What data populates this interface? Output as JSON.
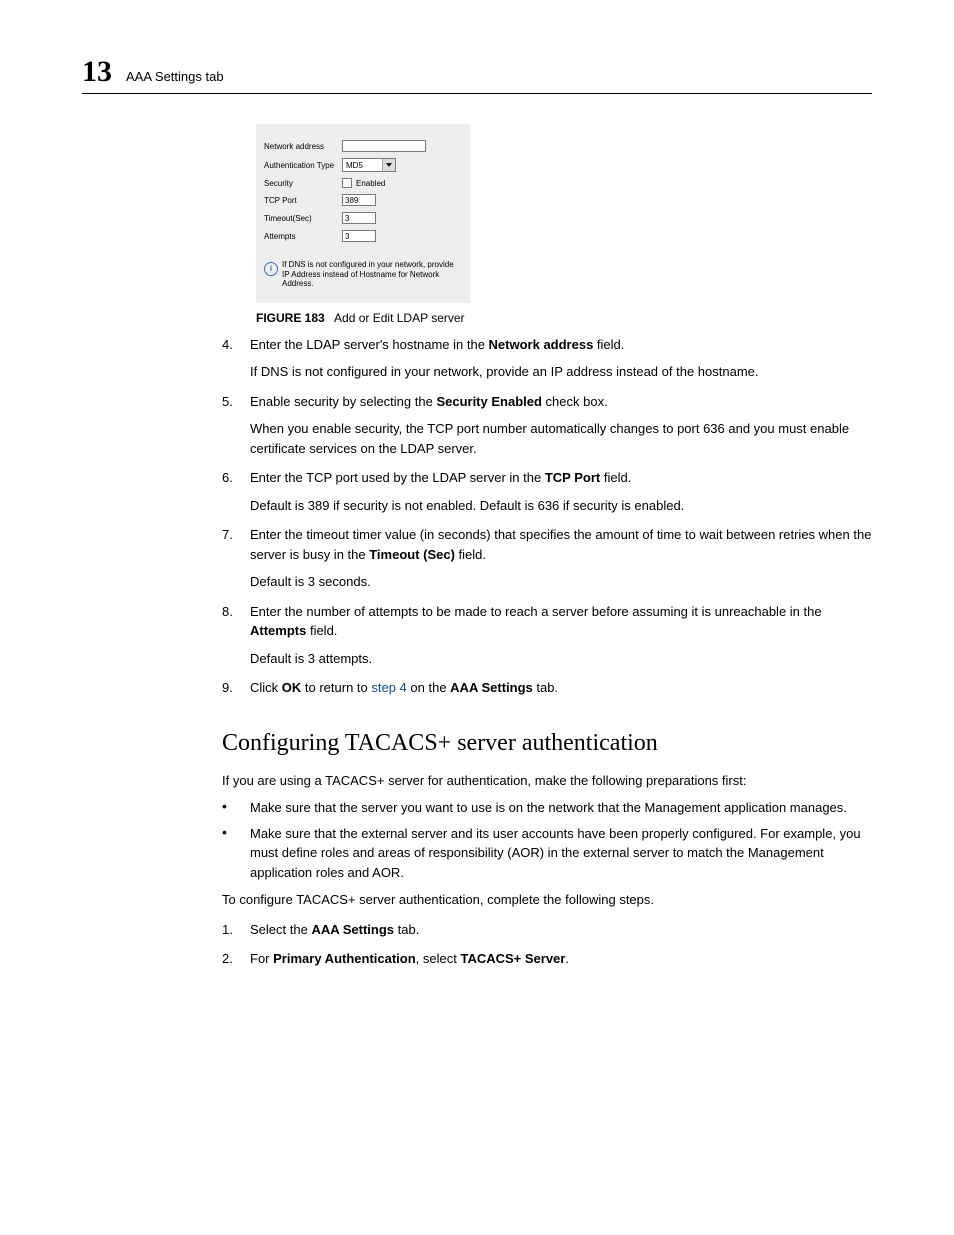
{
  "header": {
    "chapter": "13",
    "title": "AAA Settings tab"
  },
  "dialog": {
    "rows": {
      "network_address": {
        "label": "Network address",
        "value": ""
      },
      "auth_type": {
        "label": "Authentication Type",
        "value": "MD5"
      },
      "security": {
        "label": "Security",
        "checkbox_label": "Enabled"
      },
      "tcp_port": {
        "label": "TCP Port",
        "value": "389"
      },
      "timeout": {
        "label": "Timeout(Sec)",
        "value": "3"
      },
      "attempts": {
        "label": "Attempts",
        "value": "3"
      }
    },
    "note": "If DNS is not configured in your network, provide IP Address instead of Hostname for Network Address."
  },
  "figure": {
    "label": "FIGURE 183",
    "caption": "Add or Edit LDAP server"
  },
  "steps1": [
    {
      "n": "4.",
      "t1": "Enter the LDAP server's hostname in the ",
      "b1": "Network address",
      "t2": " field.",
      "sub": "If DNS is not configured in your network, provide an IP address instead of the hostname."
    },
    {
      "n": "5.",
      "t1": "Enable security by selecting the ",
      "b1": "Security Enabled",
      "t2": " check box.",
      "sub": "When you enable security, the TCP port number automatically changes to port 636 and you must enable certificate services on the LDAP server."
    },
    {
      "n": "6.",
      "t1": "Enter the TCP port used by the LDAP server in the ",
      "b1": "TCP Port",
      "t2": " field.",
      "sub": "Default is 389 if security is not enabled. Default is 636 if security is enabled."
    },
    {
      "n": "7.",
      "t1": "Enter the timeout timer value (in seconds) that specifies the amount of time to wait between retries when the server is busy in the ",
      "b1": "Timeout (Sec)",
      "t2": " field.",
      "sub": "Default is 3 seconds."
    },
    {
      "n": "8.",
      "t1": "Enter the number of attempts to be made to reach a server before assuming it is unreachable in the ",
      "b1": "Attempts",
      "t2": " field.",
      "sub": "Default is 3 attempts."
    }
  ],
  "step9": {
    "n": "9.",
    "t1": "Click ",
    "b1": "OK",
    "t2": " to return to ",
    "link": "step 4",
    "t3": " on the ",
    "b2": "AAA Settings",
    "t4": " tab."
  },
  "section2": {
    "heading": "Configuring TACACS+ server authentication",
    "intro": "If you are using a TACACS+ server for authentication, make the following preparations first:",
    "bullets": [
      "Make sure that the server you want to use is on the network that the Management application manages.",
      "Make sure that the external server and its user accounts have been properly configured. For example, you must define roles and areas of responsibility (AOR) in the external server to match the Management application roles and AOR."
    ],
    "lead": "To configure TACACS+ server authentication, complete the following steps.",
    "steps": [
      {
        "n": "1.",
        "t1": "Select the ",
        "b1": "AAA Settings",
        "t2": " tab."
      },
      {
        "n": "2.",
        "t1": "For ",
        "b1": "Primary Authentication",
        "t2": ", select ",
        "b2": "TACACS+ Server",
        "t3": "."
      }
    ]
  }
}
